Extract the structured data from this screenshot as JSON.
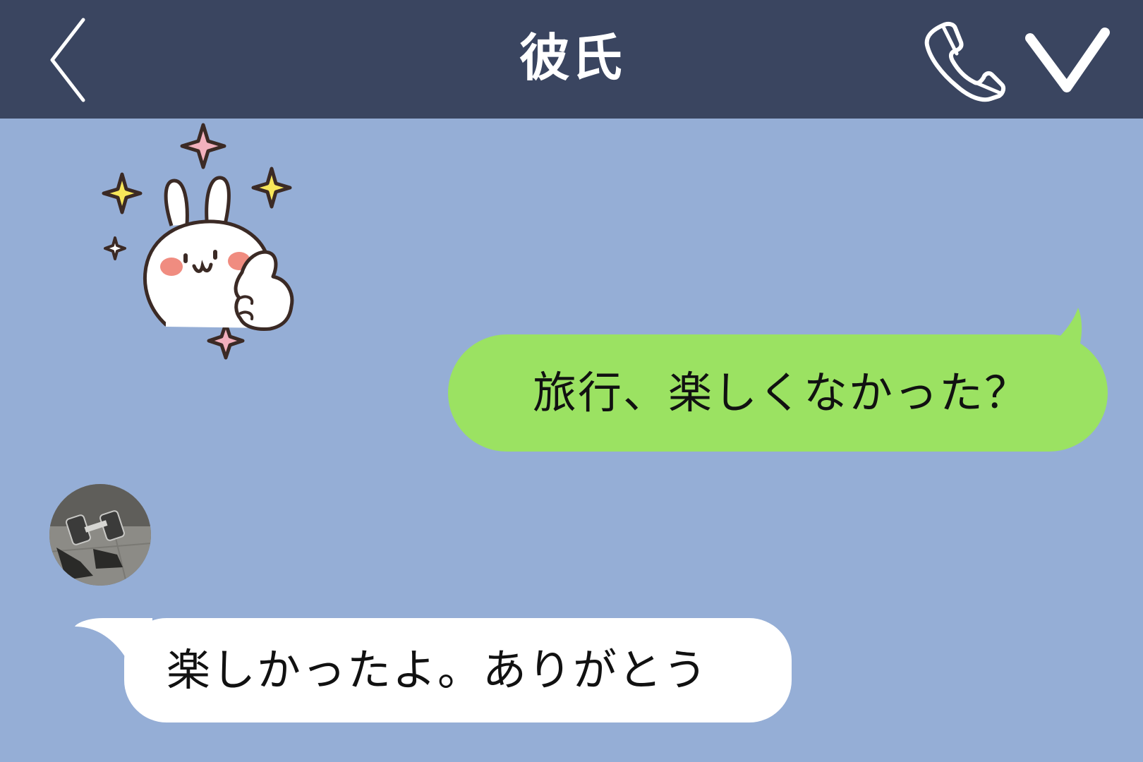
{
  "header": {
    "title": "彼氏",
    "background_color": "#3a4560",
    "back_icon": "chevron-left-icon",
    "call_icon": "phone-icon",
    "menu_icon": "chevron-down-icon"
  },
  "chat": {
    "background_color": "#95aed6",
    "messages": [
      {
        "sender": "contact",
        "kind": "sticker",
        "sticker_icon": "rabbit-thumbs-up-sticker"
      },
      {
        "sender": "me",
        "kind": "text",
        "text": "旅行、楽しくなかった？",
        "bubble_color": "#9be262"
      },
      {
        "sender": "contact",
        "kind": "text",
        "text": "楽しかったよ。ありがとう",
        "bubble_color": "#ffffff",
        "avatar_icon": "dumbbell-photo-avatar"
      }
    ]
  }
}
